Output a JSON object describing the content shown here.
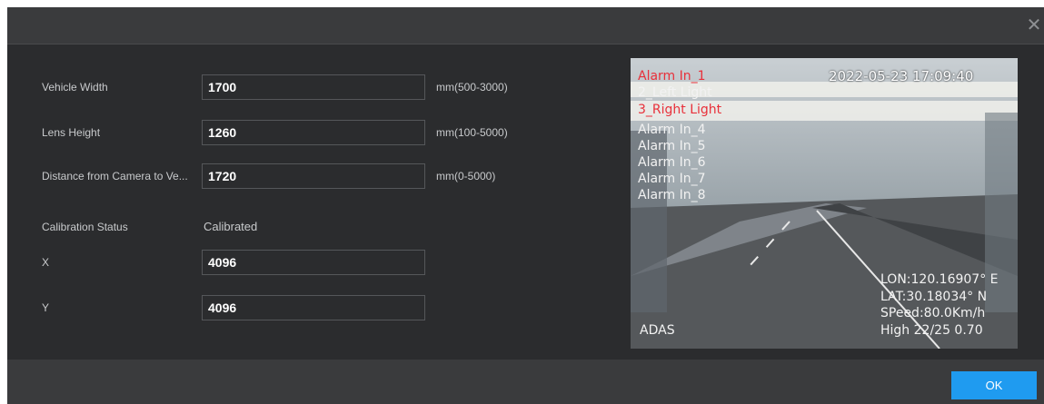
{
  "dialog": {
    "close_icon": "close-icon"
  },
  "form": {
    "vehicle_width": {
      "label": "Vehicle Width",
      "value": "1700",
      "unit": "mm(500-3000)"
    },
    "lens_height": {
      "label": "Lens Height",
      "value": "1260",
      "unit": "mm(100-5000)"
    },
    "distance": {
      "label": "Distance from Camera to Ve...",
      "value": "1720",
      "unit": "mm(0-5000)"
    },
    "calibration": {
      "label": "Calibration Status",
      "value": "Calibrated"
    },
    "x": {
      "label": "X",
      "value": "4096"
    },
    "y": {
      "label": "Y",
      "value": "4096"
    }
  },
  "preview": {
    "timestamp": "2022-05-23 17:09:40",
    "alarms": [
      "Alarm In_1",
      "2_Left Light",
      "3_Right Light",
      "Alarm In_4",
      "Alarm In_5",
      "Alarm In_6",
      "Alarm In_7",
      "Alarm In_8"
    ],
    "lon": "LON:120.16907° E",
    "lat": "LAT:30.18034° N",
    "speed": "SPeed:80.0Km/h",
    "high": "High 22/25 0.70",
    "mode": "ADAS"
  },
  "footer": {
    "ok_label": "OK"
  },
  "colors": {
    "accent": "#1f9bf0",
    "background": "#2b2c2e",
    "alarm_red": "#e8303a"
  }
}
